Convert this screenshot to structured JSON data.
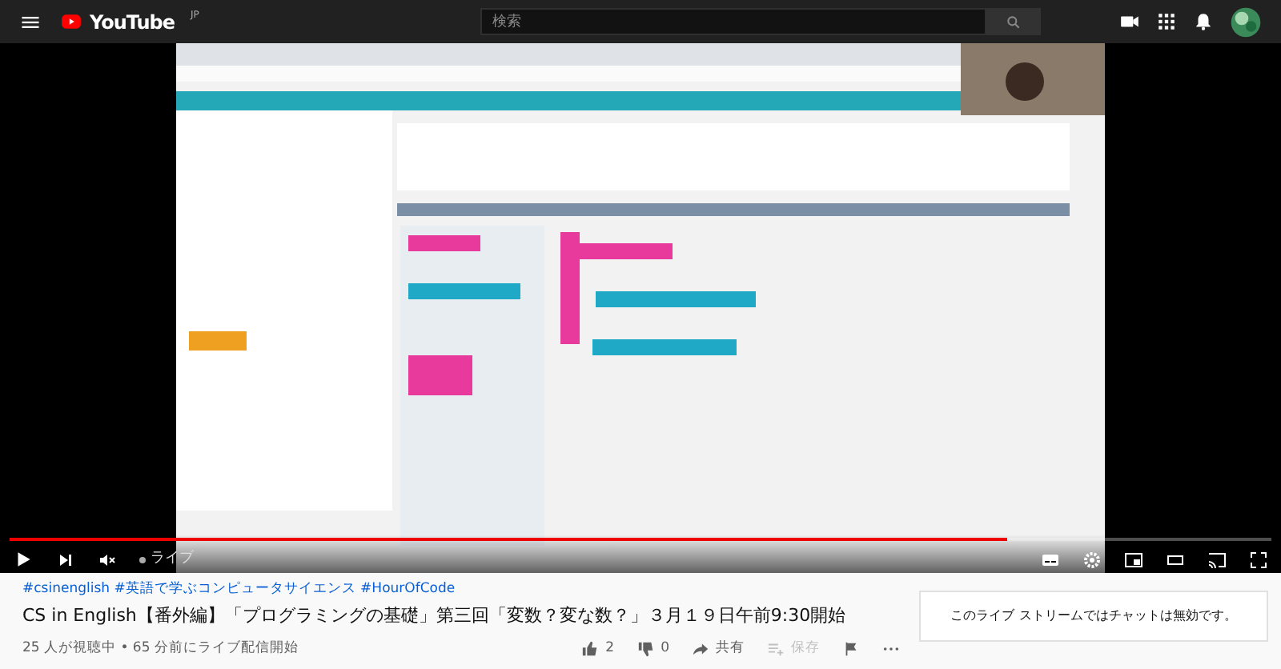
{
  "header": {
    "logo": "YouTube",
    "region": "JP",
    "search": {
      "placeholder": "検索"
    }
  },
  "player": {
    "progress": {
      "level": 0.79
    },
    "muted": true,
    "live_label": "ライブ"
  },
  "video": {
    "hashtags": "#csinenglish #英語で学ぶコンピュータサイエンス #HourOfCode",
    "title": "CS in English【番外編】「プログラミングの基礎」第三回「変数？変な数？」３月１９日午前9:30開始",
    "meta": "25 人が視聴中 • 65 分前にライブ配信開始",
    "likes": "2",
    "dislikes": "0",
    "share": "共有",
    "save": "保存"
  },
  "chat": {
    "message": "このライブ ストリームではチャットは無効です。"
  }
}
